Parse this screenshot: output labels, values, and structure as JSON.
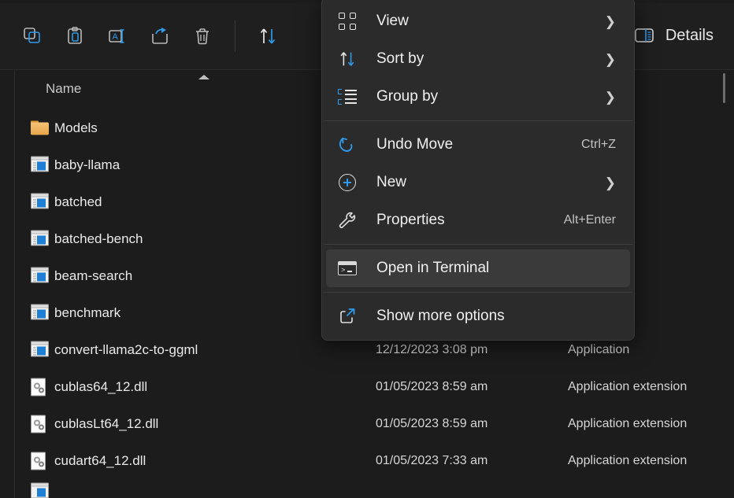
{
  "toolbar": {
    "buttons": [
      {
        "name": "copy",
        "icon": "copy-icon"
      },
      {
        "name": "paste",
        "icon": "paste-icon"
      },
      {
        "name": "rename",
        "icon": "rename-icon"
      },
      {
        "name": "share",
        "icon": "share-icon"
      },
      {
        "name": "delete",
        "icon": "trash-icon"
      },
      {
        "name": "sort",
        "icon": "sort-icon"
      }
    ],
    "details_label": "Details"
  },
  "filelist": {
    "columns": {
      "name": "Name"
    },
    "sort_direction": "ascending",
    "rows": [
      {
        "name": "Models",
        "date": "",
        "type": "",
        "icon": "folder-icon"
      },
      {
        "name": "baby-llama",
        "date": "",
        "type": "",
        "icon": "application-icon"
      },
      {
        "name": "batched",
        "date": "",
        "type": "",
        "icon": "application-icon"
      },
      {
        "name": "batched-bench",
        "date": "",
        "type": "",
        "icon": "application-icon"
      },
      {
        "name": "beam-search",
        "date": "",
        "type": "",
        "icon": "application-icon"
      },
      {
        "name": "benchmark",
        "date": "",
        "type": "",
        "icon": "application-icon"
      },
      {
        "name": "convert-llama2c-to-ggml",
        "date": "12/12/2023 3:08 pm",
        "type": "Application",
        "icon": "application-icon"
      },
      {
        "name": "cublas64_12.dll",
        "date": "01/05/2023 8:59 am",
        "type": "Application extension",
        "icon": "dll-icon"
      },
      {
        "name": "cublasLt64_12.dll",
        "date": "01/05/2023 8:59 am",
        "type": "Application extension",
        "icon": "dll-icon"
      },
      {
        "name": "cudart64_12.dll",
        "date": "01/05/2023 7:33 am",
        "type": "Application extension",
        "icon": "dll-icon"
      }
    ]
  },
  "context_menu": {
    "items": [
      {
        "label": "View",
        "icon": "grid-icon",
        "accel": "",
        "submenu": true,
        "highlighted": false
      },
      {
        "label": "Sort by",
        "icon": "sort-icon",
        "accel": "",
        "submenu": true,
        "highlighted": false
      },
      {
        "label": "Group by",
        "icon": "group-icon",
        "accel": "",
        "submenu": true,
        "highlighted": false
      },
      {
        "label": "Undo Move",
        "icon": "undo-icon",
        "accel": "Ctrl+Z",
        "submenu": false,
        "highlighted": false
      },
      {
        "label": "New",
        "icon": "plus-icon",
        "accel": "",
        "submenu": true,
        "highlighted": false
      },
      {
        "label": "Properties",
        "icon": "wrench-icon",
        "accel": "Alt+Enter",
        "submenu": false,
        "highlighted": false
      },
      {
        "label": "Open in Terminal",
        "icon": "terminal-icon",
        "accel": "",
        "submenu": false,
        "highlighted": true
      },
      {
        "label": "Show more options",
        "icon": "more-options-icon",
        "accel": "",
        "submenu": false,
        "highlighted": false
      }
    ],
    "chevron_glyph": "❯"
  },
  "colors": {
    "accent": "#2f9ae8",
    "folder": "#e8a64a",
    "menu_bg": "#2b2b2b",
    "highlight": "#3a3a3a",
    "window_bg": "#1c1c1c"
  }
}
